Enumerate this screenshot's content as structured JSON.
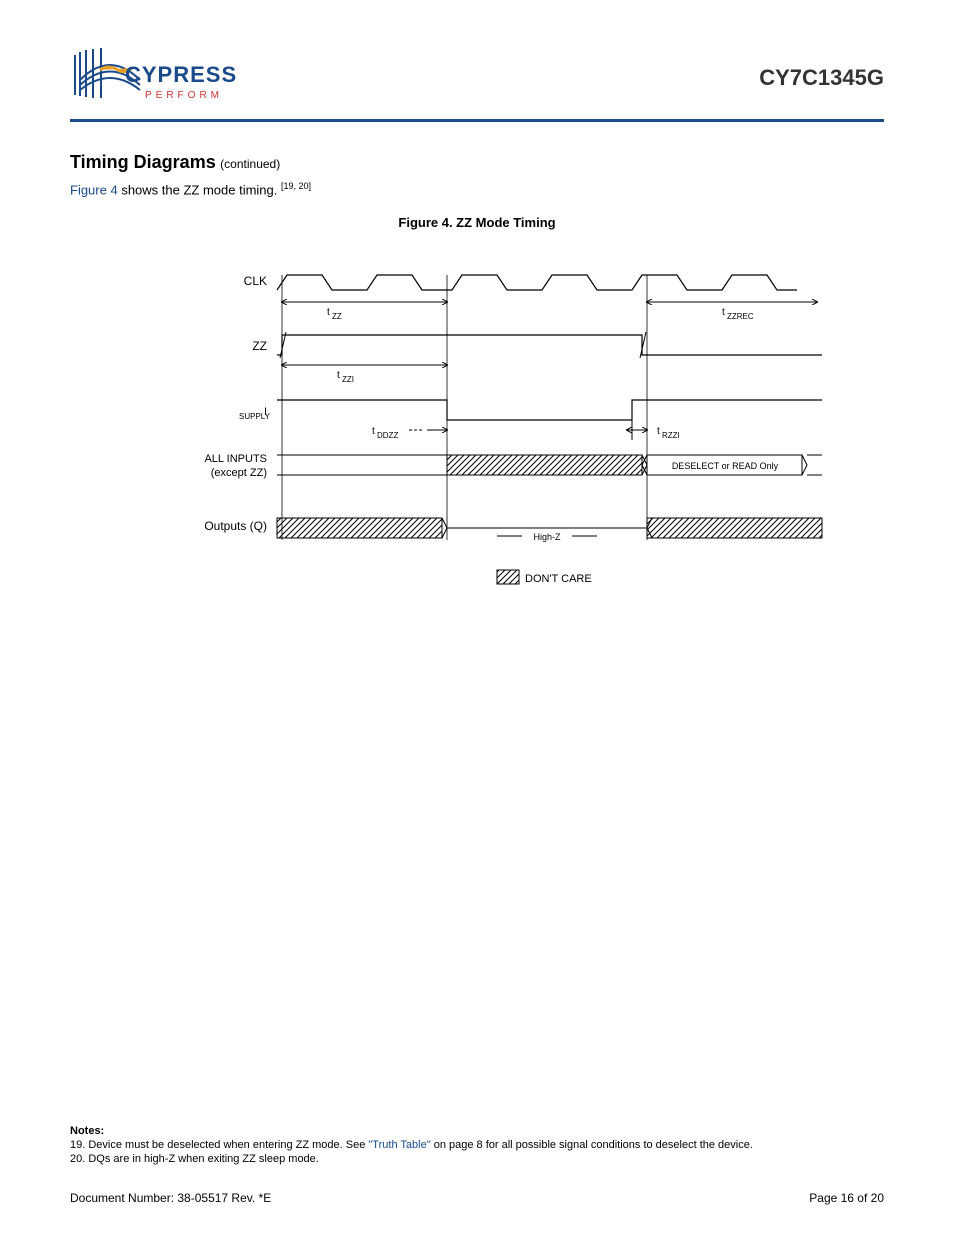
{
  "header": {
    "brand": "CYPRESS",
    "tagline": "PERFORM",
    "part_number": "CY7C1345G"
  },
  "section": {
    "title": "Timing Diagrams",
    "continued": "(continued)",
    "intro_prefix": "Figure 4",
    "intro_rest": " shows the ZZ mode timing. ",
    "intro_refs": "[19, 20]"
  },
  "figure": {
    "caption": "Figure 4.  ZZ Mode Timing",
    "signals": {
      "clk": "CLK",
      "zz": "ZZ",
      "isupply": "I SUPPLY",
      "all_inputs_line1": "ALL INPUTS",
      "all_inputs_line2": "(except ZZ)",
      "outputs": "Outputs (Q)"
    },
    "timing_labels": {
      "t_zz": "t ZZ",
      "t_zzi": "t ZZI",
      "t_ddzz": "t DDZZ",
      "t_rzzi": "t RZZI",
      "t_zzrec": "t ZZREC"
    },
    "annotations": {
      "deselect": "DESELECT or READ Only",
      "highz": "High-Z",
      "dontcare": "DON'T CARE"
    }
  },
  "notes": {
    "heading": "Notes:",
    "n19_num": "19.",
    "n19_before": "Device must be deselected when entering ZZ mode. See ",
    "n19_link": "\"Truth Table\"",
    "n19_after": " on page 8 for all possible signal conditions to deselect the device.",
    "n20_num": "20.",
    "n20_text": "DQs are in high-Z when exiting ZZ sleep mode."
  },
  "footer": {
    "docnum": "Document Number: 38-05517 Rev. *E",
    "page": "Page 16 of 20"
  }
}
